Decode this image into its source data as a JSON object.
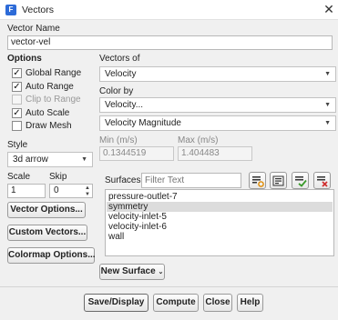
{
  "window": {
    "title": "Vectors"
  },
  "vector_name": {
    "label": "Vector Name",
    "value": "vector-vel"
  },
  "options": {
    "label": "Options",
    "items": [
      {
        "label": "Global Range",
        "checked": true,
        "enabled": true
      },
      {
        "label": "Auto Range",
        "checked": true,
        "enabled": true
      },
      {
        "label": "Clip to Range",
        "checked": false,
        "enabled": false
      },
      {
        "label": "Auto Scale",
        "checked": true,
        "enabled": true
      },
      {
        "label": "Draw Mesh",
        "checked": false,
        "enabled": true
      }
    ]
  },
  "vectors_of": {
    "label": "Vectors of",
    "value": "Velocity"
  },
  "color_by": {
    "label": "Color by",
    "value": "Velocity...",
    "sub_value": "Velocity Magnitude"
  },
  "range": {
    "min_label": "Min (m/s)",
    "min_value": "0.1344519",
    "max_label": "Max (m/s)",
    "max_value": "1.404483"
  },
  "style": {
    "label": "Style",
    "value": "3d arrow"
  },
  "scale": {
    "label": "Scale",
    "value": "1"
  },
  "skip": {
    "label": "Skip",
    "value": "0"
  },
  "side_buttons": {
    "vector_options": "Vector Options...",
    "custom_vectors": "Custom Vectors...",
    "colormap_options": "Colormap Options..."
  },
  "surfaces": {
    "label": "Surfaces",
    "filter_placeholder": "Filter Text",
    "items": [
      {
        "label": "pressure-outlet-7",
        "selected": false
      },
      {
        "label": "symmetry",
        "selected": true
      },
      {
        "label": "velocity-inlet-5",
        "selected": false
      },
      {
        "label": "velocity-inlet-6",
        "selected": false
      },
      {
        "label": "wall",
        "selected": false
      }
    ],
    "new_surface": "New Surface",
    "tool_icons": [
      "filter-icon",
      "list-options-icon",
      "select-all-icon",
      "deselect-all-icon"
    ]
  },
  "footer": {
    "save_display": "Save/Display",
    "compute": "Compute",
    "close": "Close",
    "help": "Help"
  },
  "colors": {
    "accent": "#2d6bd8",
    "selection": "#dcdcdc"
  }
}
